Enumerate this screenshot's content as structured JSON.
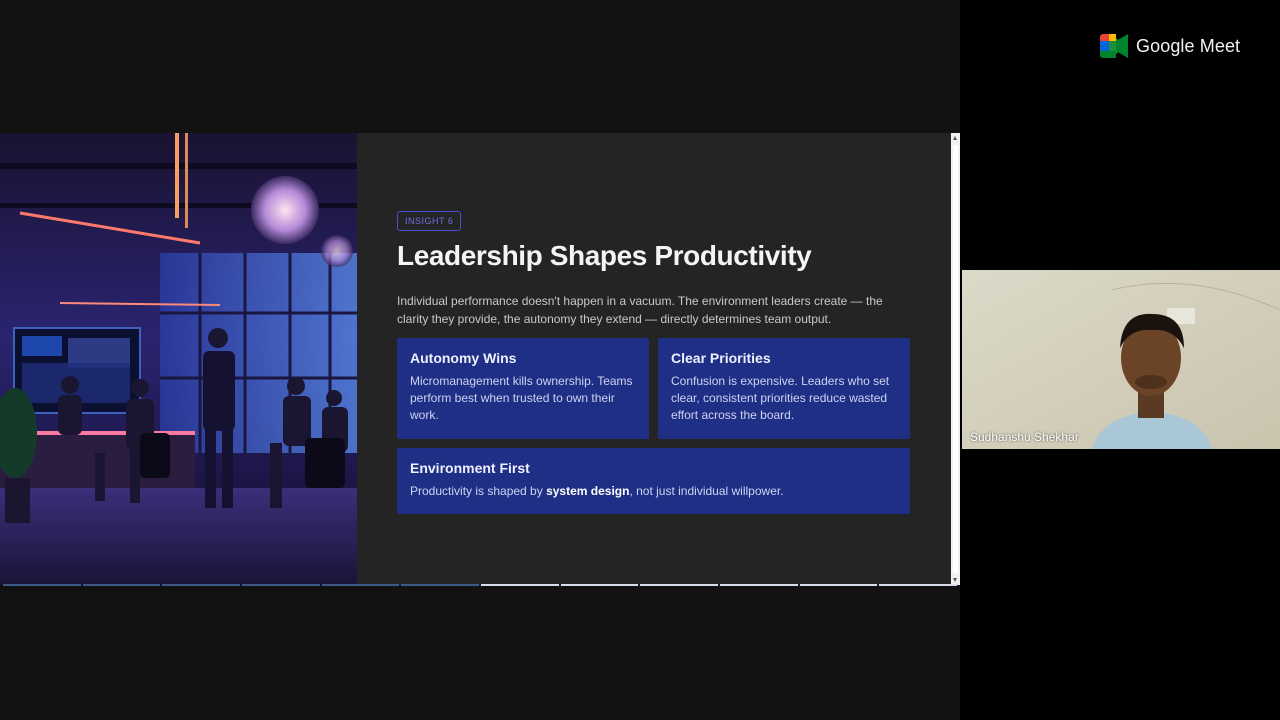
{
  "meet": {
    "brand_name": "Google Meet",
    "brand_colors": {
      "green": "#00832d",
      "blue": "#0066da",
      "red": "#ea4335",
      "yellow": "#ffba00"
    }
  },
  "slide": {
    "badge": "INSIGHT 6",
    "title": "Leadership Shapes Productivity",
    "intro": "Individual performance doesn't happen in a vacuum. The environment leaders create — the clarity they provide, the autonomy they extend — directly determines team output.",
    "cards": [
      {
        "title": "Autonomy Wins",
        "body": "Micromanagement kills ownership. Teams perform best when trusted to own their work."
      },
      {
        "title": "Clear Priorities",
        "body": "Confusion is expensive. Leaders who set clear, consistent priorities reduce wasted effort across the board."
      }
    ],
    "wide_card": {
      "title": "Environment First",
      "body_before": "Productivity is shaped by ",
      "body_bold": "system design",
      "body_after": ", not just individual willpower."
    },
    "colors": {
      "card_bg": "#1f2f85",
      "badge_border": "#4b4fd0",
      "slide_bg": "#242424"
    },
    "progress": {
      "total_segments": 12,
      "current_segment": 6
    }
  },
  "participant": {
    "name": "Sudhanshu Shekhar"
  }
}
